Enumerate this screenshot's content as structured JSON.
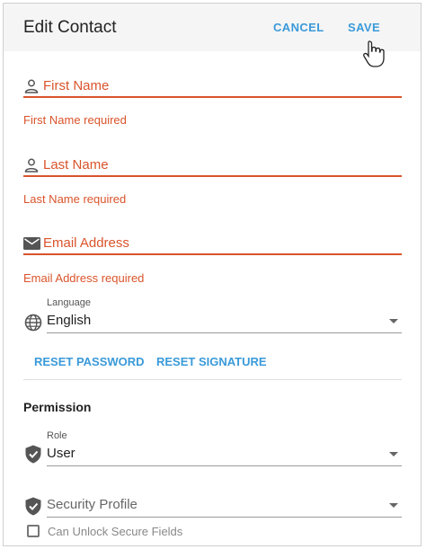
{
  "dialog": {
    "title": "Edit Contact",
    "cancel_label": "CANCEL",
    "save_label": "SAVE"
  },
  "fields": {
    "first_name": {
      "label": "First Name",
      "error": "First Name required"
    },
    "last_name": {
      "label": "Last Name",
      "error": "Last Name required"
    },
    "email": {
      "label": "Email Address",
      "error": "Email Address required"
    }
  },
  "language": {
    "label": "Language",
    "value": "English"
  },
  "actions": {
    "reset_password": "RESET PASSWORD",
    "reset_signature": "RESET SIGNATURE"
  },
  "permission": {
    "heading": "Permission",
    "role": {
      "label": "Role",
      "value": "User"
    },
    "security_profile": {
      "placeholder": "Security Profile"
    },
    "can_unlock": {
      "label": "Can Unlock Secure Fields",
      "checked": false
    }
  },
  "colors": {
    "accent": "#3a9ad9",
    "error": "#d9542b"
  },
  "icons": {
    "first_name": "person-icon",
    "last_name": "person-icon",
    "email": "envelope-icon",
    "language": "globe-icon",
    "role": "shield-check-icon",
    "security_profile": "shield-check-icon",
    "cursor": "hand-pointer-icon"
  }
}
